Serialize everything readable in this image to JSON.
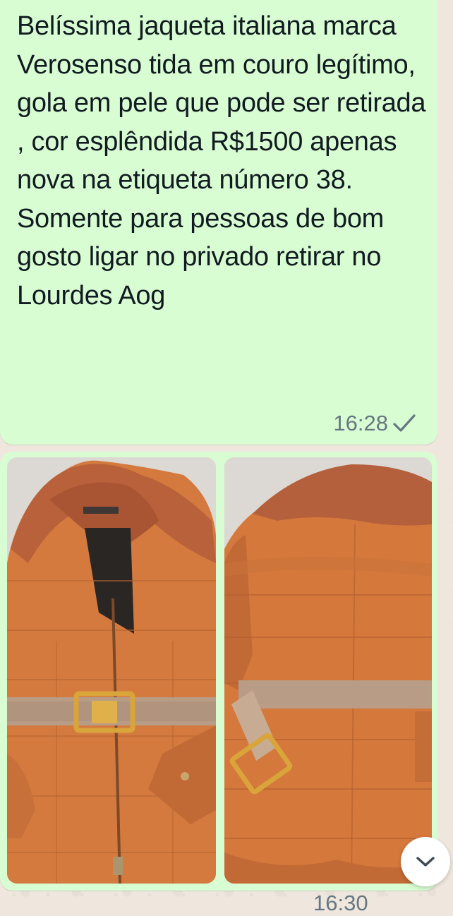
{
  "message": {
    "text": "Belíssima jaqueta italiana marca Verosenso tida em couro legítimo, gola em pele que pode ser retirada , cor esplêndida R$1500 apenas nova na etiqueta número 38. Somente para pessoas de bom gosto ligar no privado retirar no Lourdes Aog",
    "time": "16:28",
    "status_icon": "check-icon"
  },
  "images": {
    "left_alt": "Jaqueta de couro laranja vista de frente com gola de pele",
    "right_alt": "Jaqueta de couro laranja vista de costas com cinto"
  },
  "next_message": {
    "time": "16:30"
  },
  "scroll_button": {
    "icon": "chevron-down-icon"
  },
  "colors": {
    "bubble": "#d9fdd3",
    "background": "#efe7de",
    "text": "#111b21",
    "meta": "#667781",
    "jacket": "#d2773b"
  }
}
